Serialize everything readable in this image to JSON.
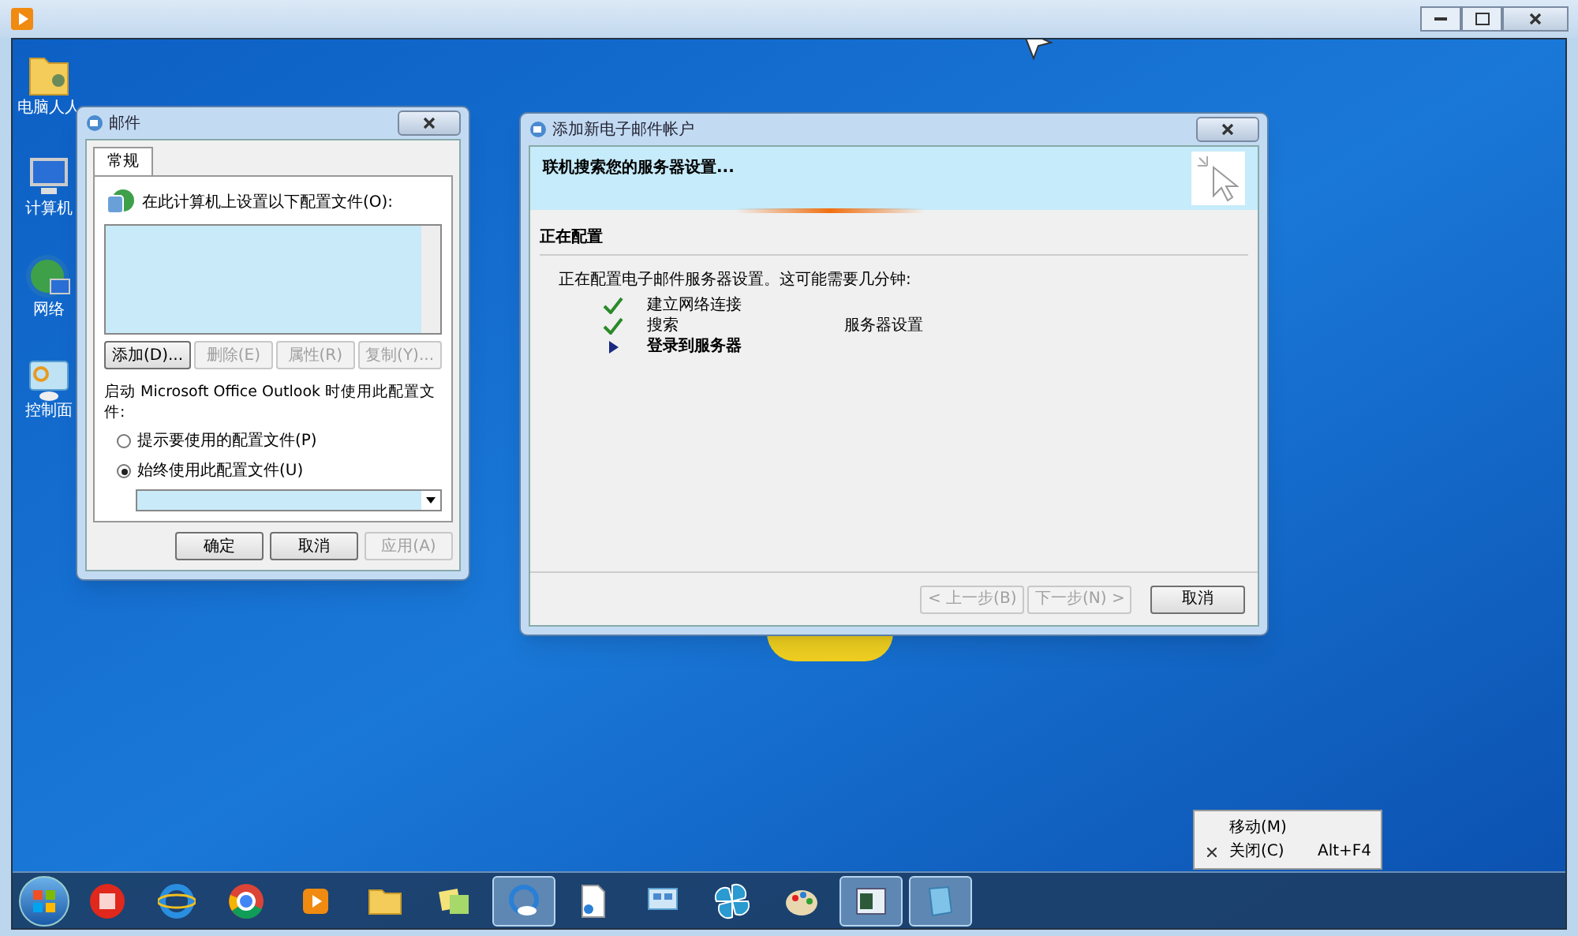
{
  "desktop_icons": [
    {
      "label": "电脑人人",
      "kind": "user-folder"
    },
    {
      "label": "计算机",
      "kind": "computer"
    },
    {
      "label": "网络",
      "kind": "network"
    },
    {
      "label": "控制面",
      "kind": "control-panel"
    }
  ],
  "mail_dialog": {
    "title": "邮件",
    "tabs": [
      {
        "label": "常规",
        "selected": true
      }
    ],
    "profiles_label": "在此计算机上设置以下配置文件(O):",
    "buttons": [
      {
        "label": "添加(D)...",
        "disabled": false
      },
      {
        "label": "删除(E)",
        "disabled": true
      },
      {
        "label": "属性(R)",
        "disabled": true
      },
      {
        "label": "复制(Y)...",
        "disabled": true
      }
    ],
    "startup_label": "启动 Microsoft Office Outlook 时使用此配置文件:",
    "options": [
      {
        "label": "提示要使用的配置文件(P)",
        "selected": false
      },
      {
        "label": "始终使用此配置文件(U)",
        "selected": true
      }
    ],
    "footer_buttons": [
      {
        "label": "确定",
        "disabled": false
      },
      {
        "label": "取消",
        "disabled": false
      },
      {
        "label": "应用(A)",
        "disabled": true
      }
    ]
  },
  "wizard": {
    "title": "添加新电子邮件帐户",
    "header": "联机搜索您的服务器设置...",
    "section": "正在配置",
    "description": "正在配置电子邮件服务器设置。这可能需要几分钟:",
    "steps": [
      {
        "label": "建立网络连接",
        "kind": "done"
      },
      {
        "label": "搜索",
        "kind": "done",
        "detail": "服务器设置"
      },
      {
        "label": "登录到服务器",
        "kind": "current"
      }
    ],
    "buttons": [
      {
        "label": "< 上一步(B)",
        "disabled": true
      },
      {
        "label": "下一步(N) >",
        "disabled": true
      },
      {
        "label": "取消",
        "disabled": false
      }
    ]
  },
  "context_menu": {
    "items": [
      {
        "label": "移动(M)"
      },
      {
        "label": "关闭(C)",
        "shortcut": "Alt+F4"
      }
    ]
  },
  "taskbar": {
    "items": [
      {
        "kind": "flag",
        "selected": false
      },
      {
        "kind": "globe-e",
        "selected": false
      },
      {
        "kind": "chrome",
        "selected": false
      },
      {
        "kind": "player",
        "selected": false
      },
      {
        "kind": "folder",
        "selected": false
      },
      {
        "kind": "notes",
        "selected": false
      },
      {
        "kind": "cloud",
        "selected": true
      },
      {
        "kind": "document",
        "selected": false
      },
      {
        "kind": "panel",
        "selected": false
      },
      {
        "kind": "pinwheel",
        "selected": false
      },
      {
        "kind": "palette",
        "selected": false
      },
      {
        "kind": "window",
        "selected": true
      },
      {
        "kind": "book",
        "selected": true
      }
    ]
  }
}
